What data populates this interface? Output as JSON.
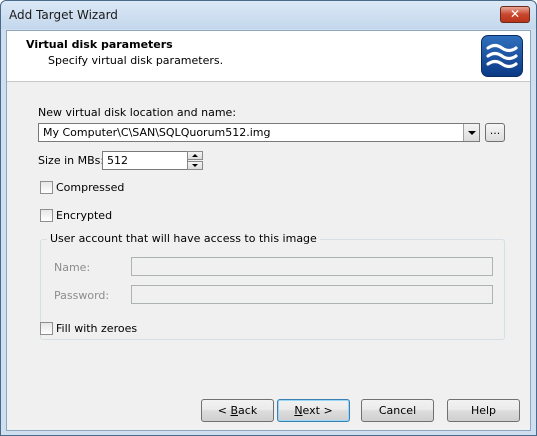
{
  "window": {
    "title": "Add Target Wizard",
    "close_glyph": "✕"
  },
  "header": {
    "title": "Virtual disk parameters",
    "subtitle": "Specify virtual disk parameters.",
    "logo_icon": "waves-logo-icon",
    "logo_color": "#1b56a6"
  },
  "location": {
    "label": "New virtual disk location and name:",
    "value": "My Computer\\C\\SAN\\SQLQuorum512.img",
    "browse_label": "..."
  },
  "size": {
    "label": "Size in MBs:",
    "value": "512"
  },
  "options": {
    "compressed_label": "Compressed",
    "encrypted_label": "Encrypted",
    "fill_zeroes_label": "Fill with zeroes",
    "compressed_checked": false,
    "encrypted_checked": false,
    "fill_zeroes_checked": false
  },
  "user_account": {
    "caption": "User account that will have access to this image",
    "name_label": "Name:",
    "name_value": "",
    "password_label": "Password:",
    "password_value": ""
  },
  "buttons": {
    "back_label": "< Back",
    "back_mnemonic": "B",
    "next_label": "Next >",
    "next_mnemonic": "N",
    "cancel_label": "Cancel",
    "help_label": "Help"
  }
}
